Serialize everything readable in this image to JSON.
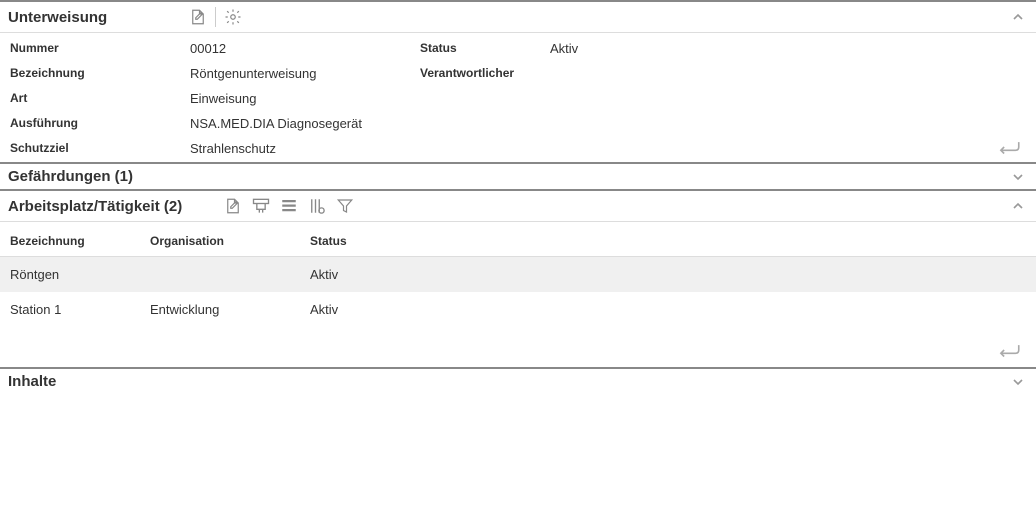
{
  "panels": {
    "unterweisung": {
      "title": "Unterweisung",
      "fields": {
        "nummer": {
          "label": "Nummer",
          "value": "00012"
        },
        "status": {
          "label": "Status",
          "value": "Aktiv"
        },
        "bezeichnung": {
          "label": "Bezeichnung",
          "value": "Röntgenunterweisung"
        },
        "verantwortlicher": {
          "label": "Verantwortlicher",
          "value": ""
        },
        "art": {
          "label": "Art",
          "value": "Einweisung"
        },
        "ausfuehrung": {
          "label": "Ausführung",
          "value": "NSA.MED.DIA Diagnosegerät"
        },
        "schutzziel": {
          "label": "Schutzziel",
          "value": "Strahlenschutz"
        }
      }
    },
    "gefaehrdungen": {
      "title": "Gefährdungen (1)"
    },
    "arbeitsplatz": {
      "title": "Arbeitsplatz/Tätigkeit (2)",
      "columns": {
        "bezeichnung": "Bezeichnung",
        "organisation": "Organisation",
        "status": "Status"
      },
      "rows": [
        {
          "bezeichnung": "Röntgen",
          "organisation": "",
          "status": "Aktiv"
        },
        {
          "bezeichnung": "Station 1",
          "organisation": "Entwicklung",
          "status": "Aktiv"
        }
      ]
    },
    "inhalte": {
      "title": "Inhalte"
    }
  }
}
